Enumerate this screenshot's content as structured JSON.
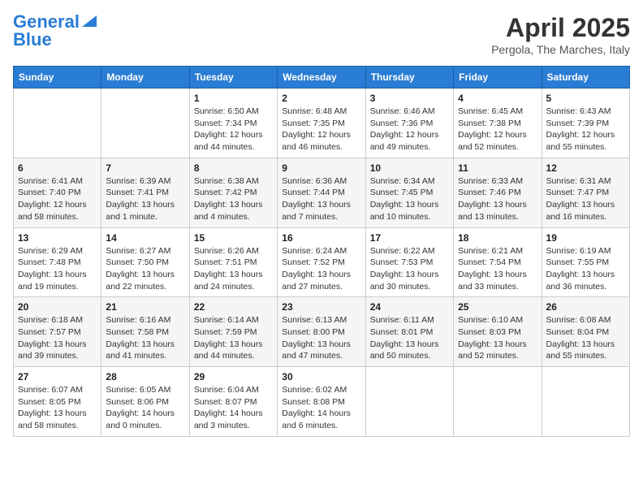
{
  "header": {
    "logo_text_general": "General",
    "logo_text_blue": "Blue",
    "month_title": "April 2025",
    "subtitle": "Pergola, The Marches, Italy"
  },
  "days_of_week": [
    "Sunday",
    "Monday",
    "Tuesday",
    "Wednesday",
    "Thursday",
    "Friday",
    "Saturday"
  ],
  "weeks": [
    [
      {
        "day": "",
        "info": ""
      },
      {
        "day": "",
        "info": ""
      },
      {
        "day": "1",
        "info": "Sunrise: 6:50 AM\nSunset: 7:34 PM\nDaylight: 12 hours and 44 minutes."
      },
      {
        "day": "2",
        "info": "Sunrise: 6:48 AM\nSunset: 7:35 PM\nDaylight: 12 hours and 46 minutes."
      },
      {
        "day": "3",
        "info": "Sunrise: 6:46 AM\nSunset: 7:36 PM\nDaylight: 12 hours and 49 minutes."
      },
      {
        "day": "4",
        "info": "Sunrise: 6:45 AM\nSunset: 7:38 PM\nDaylight: 12 hours and 52 minutes."
      },
      {
        "day": "5",
        "info": "Sunrise: 6:43 AM\nSunset: 7:39 PM\nDaylight: 12 hours and 55 minutes."
      }
    ],
    [
      {
        "day": "6",
        "info": "Sunrise: 6:41 AM\nSunset: 7:40 PM\nDaylight: 12 hours and 58 minutes."
      },
      {
        "day": "7",
        "info": "Sunrise: 6:39 AM\nSunset: 7:41 PM\nDaylight: 13 hours and 1 minute."
      },
      {
        "day": "8",
        "info": "Sunrise: 6:38 AM\nSunset: 7:42 PM\nDaylight: 13 hours and 4 minutes."
      },
      {
        "day": "9",
        "info": "Sunrise: 6:36 AM\nSunset: 7:44 PM\nDaylight: 13 hours and 7 minutes."
      },
      {
        "day": "10",
        "info": "Sunrise: 6:34 AM\nSunset: 7:45 PM\nDaylight: 13 hours and 10 minutes."
      },
      {
        "day": "11",
        "info": "Sunrise: 6:33 AM\nSunset: 7:46 PM\nDaylight: 13 hours and 13 minutes."
      },
      {
        "day": "12",
        "info": "Sunrise: 6:31 AM\nSunset: 7:47 PM\nDaylight: 13 hours and 16 minutes."
      }
    ],
    [
      {
        "day": "13",
        "info": "Sunrise: 6:29 AM\nSunset: 7:48 PM\nDaylight: 13 hours and 19 minutes."
      },
      {
        "day": "14",
        "info": "Sunrise: 6:27 AM\nSunset: 7:50 PM\nDaylight: 13 hours and 22 minutes."
      },
      {
        "day": "15",
        "info": "Sunrise: 6:26 AM\nSunset: 7:51 PM\nDaylight: 13 hours and 24 minutes."
      },
      {
        "day": "16",
        "info": "Sunrise: 6:24 AM\nSunset: 7:52 PM\nDaylight: 13 hours and 27 minutes."
      },
      {
        "day": "17",
        "info": "Sunrise: 6:22 AM\nSunset: 7:53 PM\nDaylight: 13 hours and 30 minutes."
      },
      {
        "day": "18",
        "info": "Sunrise: 6:21 AM\nSunset: 7:54 PM\nDaylight: 13 hours and 33 minutes."
      },
      {
        "day": "19",
        "info": "Sunrise: 6:19 AM\nSunset: 7:55 PM\nDaylight: 13 hours and 36 minutes."
      }
    ],
    [
      {
        "day": "20",
        "info": "Sunrise: 6:18 AM\nSunset: 7:57 PM\nDaylight: 13 hours and 39 minutes."
      },
      {
        "day": "21",
        "info": "Sunrise: 6:16 AM\nSunset: 7:58 PM\nDaylight: 13 hours and 41 minutes."
      },
      {
        "day": "22",
        "info": "Sunrise: 6:14 AM\nSunset: 7:59 PM\nDaylight: 13 hours and 44 minutes."
      },
      {
        "day": "23",
        "info": "Sunrise: 6:13 AM\nSunset: 8:00 PM\nDaylight: 13 hours and 47 minutes."
      },
      {
        "day": "24",
        "info": "Sunrise: 6:11 AM\nSunset: 8:01 PM\nDaylight: 13 hours and 50 minutes."
      },
      {
        "day": "25",
        "info": "Sunrise: 6:10 AM\nSunset: 8:03 PM\nDaylight: 13 hours and 52 minutes."
      },
      {
        "day": "26",
        "info": "Sunrise: 6:08 AM\nSunset: 8:04 PM\nDaylight: 13 hours and 55 minutes."
      }
    ],
    [
      {
        "day": "27",
        "info": "Sunrise: 6:07 AM\nSunset: 8:05 PM\nDaylight: 13 hours and 58 minutes."
      },
      {
        "day": "28",
        "info": "Sunrise: 6:05 AM\nSunset: 8:06 PM\nDaylight: 14 hours and 0 minutes."
      },
      {
        "day": "29",
        "info": "Sunrise: 6:04 AM\nSunset: 8:07 PM\nDaylight: 14 hours and 3 minutes."
      },
      {
        "day": "30",
        "info": "Sunrise: 6:02 AM\nSunset: 8:08 PM\nDaylight: 14 hours and 6 minutes."
      },
      {
        "day": "",
        "info": ""
      },
      {
        "day": "",
        "info": ""
      },
      {
        "day": "",
        "info": ""
      }
    ]
  ]
}
